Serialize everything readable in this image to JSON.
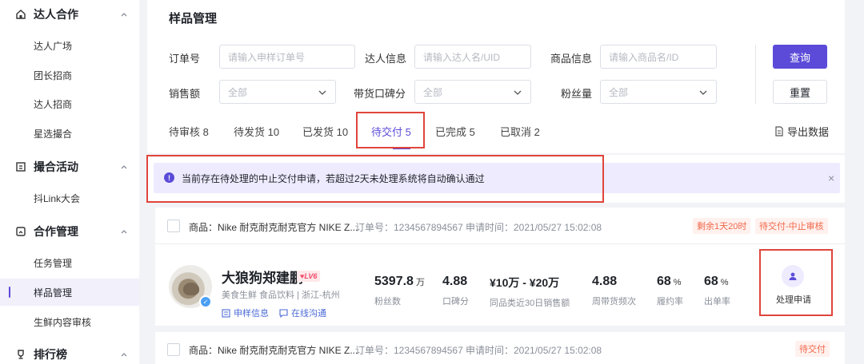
{
  "sidebar": {
    "groups": [
      {
        "label": "达人合作",
        "icon": "home-icon",
        "items": [
          "达人广场",
          "团长招商",
          "达人招商",
          "星选撮合"
        ]
      },
      {
        "label": "撮合活动",
        "icon": "calendar-icon",
        "items": [
          "抖Link大会"
        ]
      },
      {
        "label": "合作管理",
        "icon": "clipboard-icon",
        "items": [
          "任务管理",
          "样品管理",
          "生鲜内容审核"
        ],
        "active_item": "样品管理"
      },
      {
        "label": "排行榜",
        "icon": "trophy-icon",
        "items": []
      }
    ]
  },
  "page": {
    "title": "样品管理"
  },
  "filters": {
    "order_no": {
      "label": "订单号",
      "placeholder": "请输入申样订单号"
    },
    "influencer": {
      "label": "达人信息",
      "placeholder": "请输入达人名/UID"
    },
    "product": {
      "label": "商品信息",
      "placeholder": "请输入商品名/ID"
    },
    "sales": {
      "label": "销售额",
      "value": "全部"
    },
    "reputation": {
      "label": "带货口碑分",
      "value": "全部"
    },
    "fans": {
      "label": "粉丝量",
      "value": "全部"
    },
    "search_label": "查询",
    "reset_label": "重置"
  },
  "tabs": [
    {
      "label": "待审核 8"
    },
    {
      "label": "待发货 10"
    },
    {
      "label": "已发货 10"
    },
    {
      "label": "待交付 5",
      "active": true
    },
    {
      "label": "已完成 5"
    },
    {
      "label": "已取消 2"
    }
  ],
  "export_label": "导出数据",
  "alert": {
    "text": "当前存在待处理的中止交付申请，若超过2天未处理系统将自动确认通过",
    "close": "×"
  },
  "orders": [
    {
      "product": "商品：Nike 耐克耐克耐克官方 NIKE Z...",
      "order_no": "订单号：1234567894567",
      "apply_time": "申请时间：2021/05/27 15:02:08",
      "countdown": "剩余1天20时",
      "status": "待交付-中止审核",
      "influencer": {
        "name": "大狼狗郑建鹏",
        "level": "LV6",
        "tags": "美食生鲜  食品饮料  |  浙江-杭州",
        "sample_info": "申样信息",
        "chat": "在线沟通"
      },
      "stats": [
        {
          "value": "5397.8",
          "unit": "万",
          "label": "粉丝数"
        },
        {
          "value": "4.88",
          "unit": "",
          "label": "口碑分"
        },
        {
          "value": "¥10万 - ¥20万",
          "unit": "",
          "label": "同品类近30日销售额"
        },
        {
          "value": "4.88",
          "unit": "",
          "label": "周带货频次"
        },
        {
          "value": "68",
          "unit": "%",
          "label": "履约率"
        },
        {
          "value": "68",
          "unit": "%",
          "label": "出单率"
        }
      ],
      "action": "处理申请"
    },
    {
      "product": "商品：Nike 耐克耐克耐克官方 NIKE Z...",
      "order_no": "订单号：1234567894567",
      "apply_time": "申请时间：2021/05/27 15:02:08",
      "status": "待交付"
    }
  ],
  "colors": {
    "accent": "#5b4bd8",
    "highlight_border": "#e0453c",
    "status_text": "#f2684a"
  }
}
